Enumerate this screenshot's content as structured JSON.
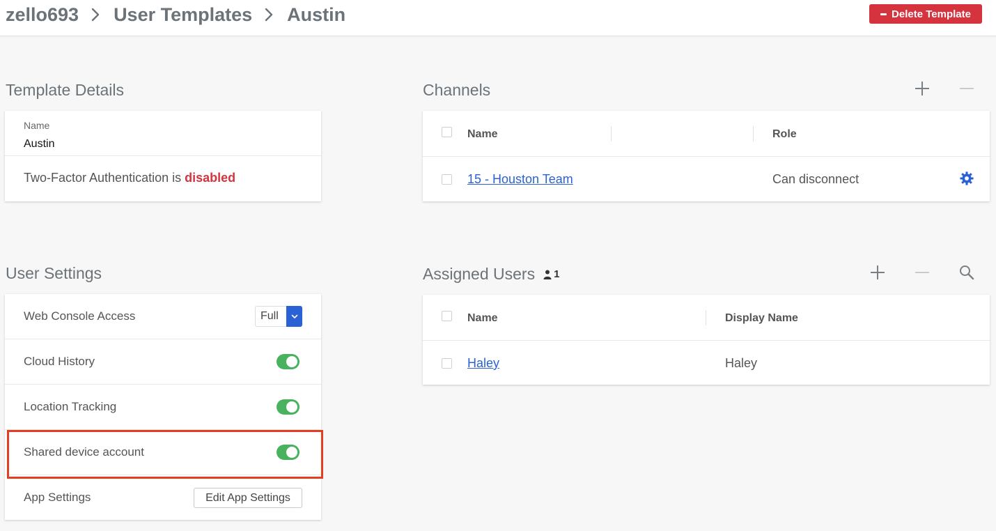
{
  "breadcrumb": {
    "org": "zello693",
    "section": "User Templates",
    "current": "Austin"
  },
  "header": {
    "delete_label": "Delete Template"
  },
  "template_details": {
    "title": "Template Details",
    "name_label": "Name",
    "name_value": "Austin",
    "two_factor_prefix": "Two-Factor Authentication is ",
    "two_factor_status": "disabled"
  },
  "channels": {
    "title": "Channels",
    "columns": {
      "name": "Name",
      "role": "Role"
    },
    "rows": [
      {
        "name": "15 - Houston Team",
        "role": "Can disconnect"
      }
    ]
  },
  "user_settings": {
    "title": "User Settings",
    "web_console_label": "Web Console Access",
    "web_console_value": "Full",
    "cloud_history_label": "Cloud History",
    "cloud_history_on": true,
    "location_tracking_label": "Location Tracking",
    "location_tracking_on": true,
    "shared_device_label": "Shared device account",
    "shared_device_on": true,
    "app_settings_label": "App Settings",
    "edit_app_settings_label": "Edit App Settings"
  },
  "assigned_users": {
    "title": "Assigned Users",
    "count": "1",
    "columns": {
      "name": "Name",
      "display_name": "Display Name"
    },
    "rows": [
      {
        "name": "Haley",
        "display_name": "Haley"
      }
    ]
  },
  "colors": {
    "accent": "#2a62d6",
    "danger": "#d5333e",
    "toggle_on": "#49b25e",
    "highlight": "#e23e22"
  }
}
